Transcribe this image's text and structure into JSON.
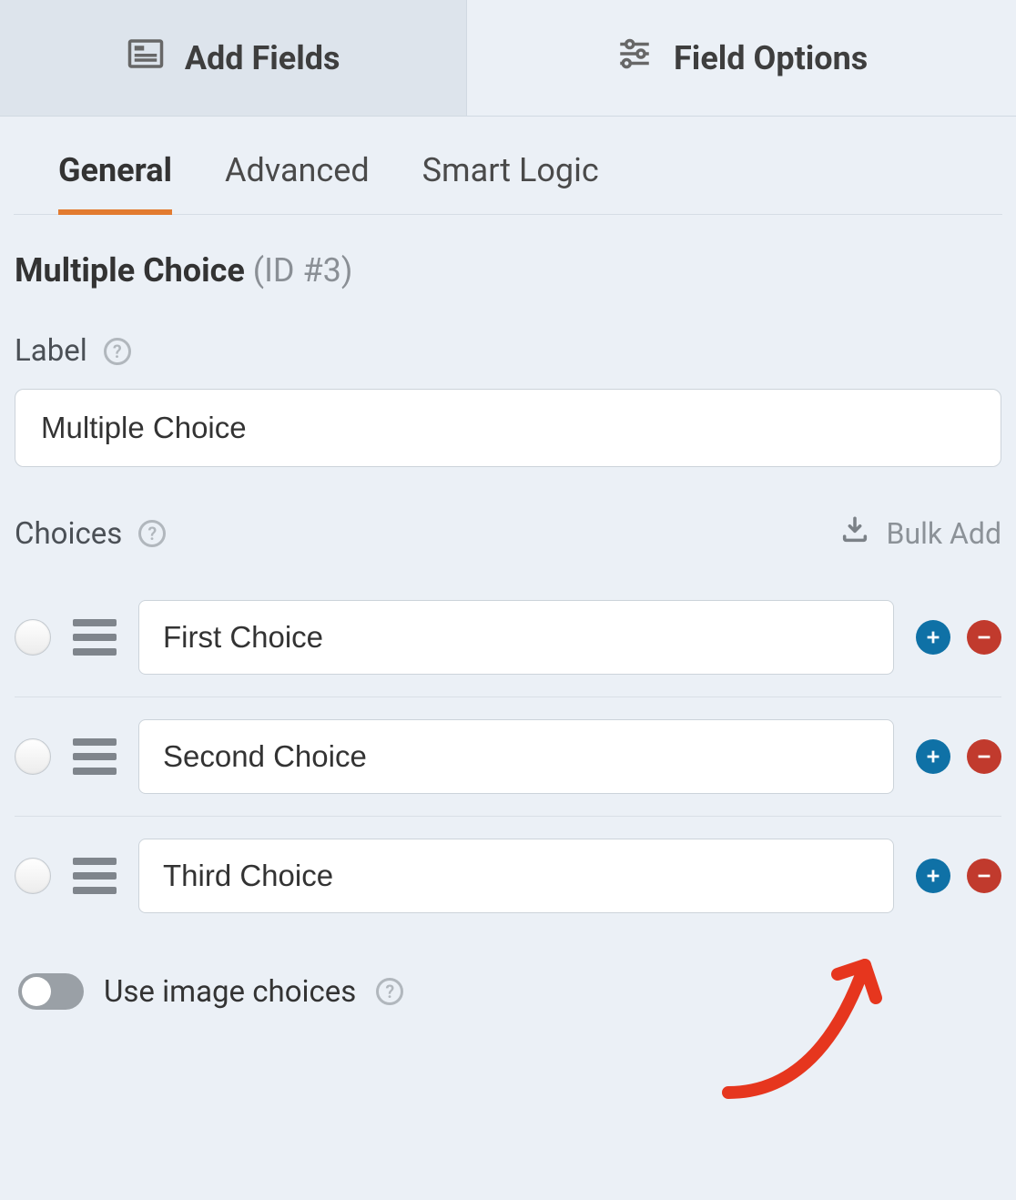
{
  "topTabs": {
    "addFields": "Add Fields",
    "fieldOptions": "Field Options"
  },
  "subTabs": {
    "general": "General",
    "advanced": "Advanced",
    "smartLogic": "Smart Logic"
  },
  "field": {
    "type": "Multiple Choice",
    "idLabel": "(ID #3)"
  },
  "labelSection": {
    "caption": "Label",
    "value": "Multiple Choice"
  },
  "choicesSection": {
    "caption": "Choices",
    "bulkAdd": "Bulk Add",
    "items": [
      {
        "value": "First Choice"
      },
      {
        "value": "Second Choice"
      },
      {
        "value": "Third Choice"
      }
    ]
  },
  "imageChoices": {
    "label": "Use image choices",
    "enabled": false
  }
}
